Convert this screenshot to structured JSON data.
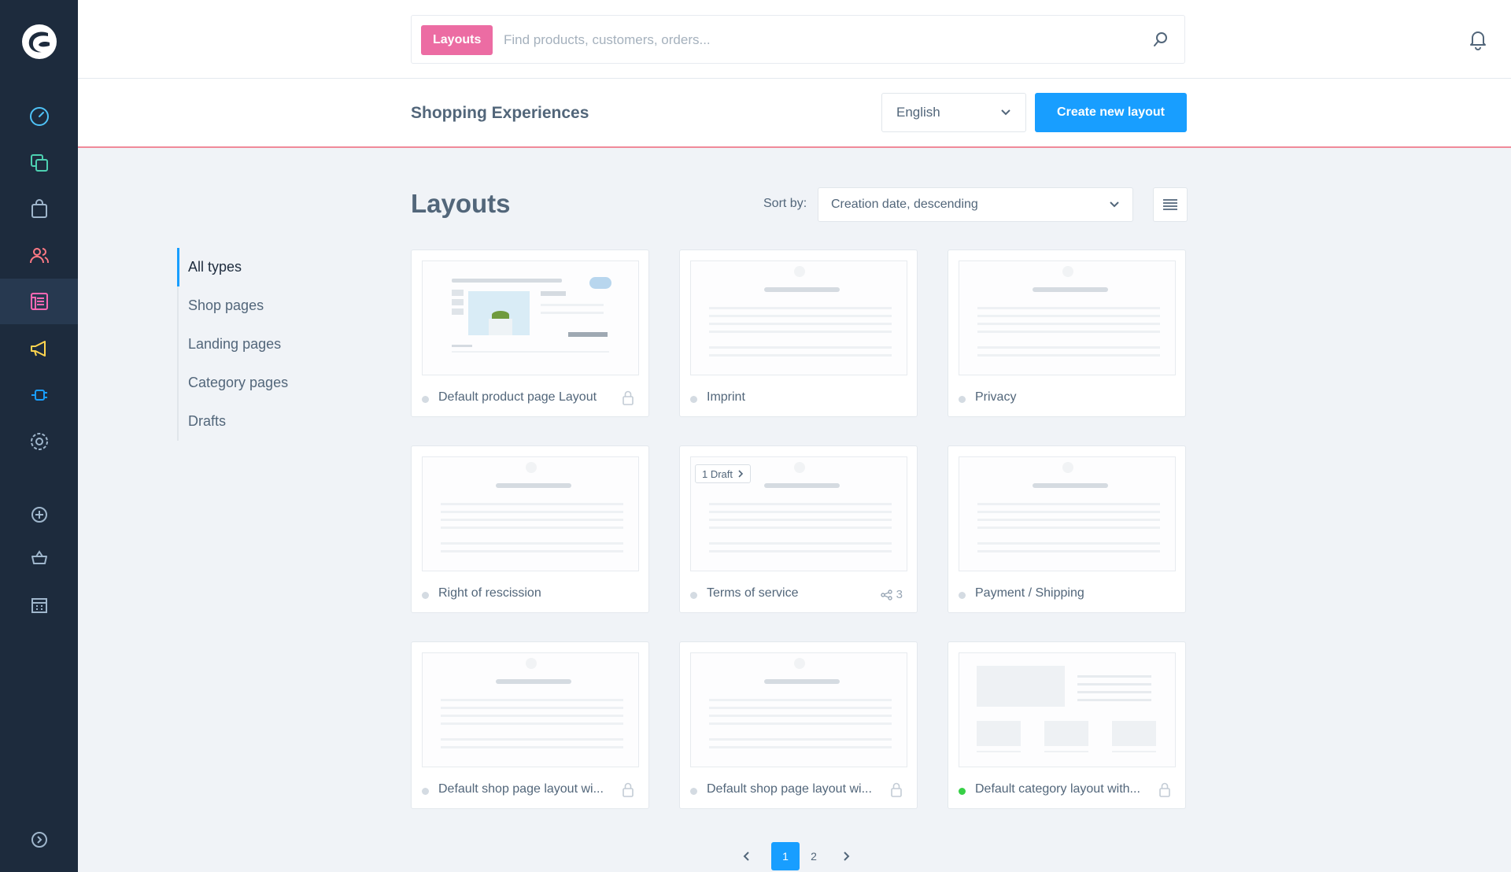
{
  "search": {
    "badge": "Layouts",
    "placeholder": "Find products, customers, orders..."
  },
  "sidebar": {
    "items": [
      {
        "name": "dashboard",
        "icon": "gauge-icon",
        "color": "#4fc3f7"
      },
      {
        "name": "catalogues",
        "icon": "copy-icon",
        "color": "#4dd0b1"
      },
      {
        "name": "orders",
        "icon": "bag-icon",
        "color": "#9fb6cc"
      },
      {
        "name": "customers",
        "icon": "users-icon",
        "color": "#ff7a85"
      },
      {
        "name": "content",
        "icon": "content-icon",
        "color": "#ff68b4",
        "active": true
      },
      {
        "name": "marketing",
        "icon": "megaphone-icon",
        "color": "#ffd54f"
      },
      {
        "name": "extensions",
        "icon": "plug-icon",
        "color": "#189eff"
      },
      {
        "name": "settings",
        "icon": "gear-icon",
        "color": "#9fb6cc"
      },
      {
        "name": "add",
        "icon": "plus-circle-icon",
        "color": "#9fb6cc"
      },
      {
        "name": "shop",
        "icon": "basket-icon",
        "color": "#9fb6cc"
      },
      {
        "name": "storefront",
        "icon": "store-icon",
        "color": "#9fb6cc"
      },
      {
        "name": "expand",
        "icon": "chevron-right-circle-icon",
        "color": "#9fb6cc"
      }
    ]
  },
  "header": {
    "title": "Shopping Experiences",
    "language": "English",
    "create_label": "Create new layout"
  },
  "filters": [
    {
      "label": "All types",
      "active": true
    },
    {
      "label": "Shop pages"
    },
    {
      "label": "Landing pages"
    },
    {
      "label": "Category pages"
    },
    {
      "label": "Drafts"
    }
  ],
  "main": {
    "title": "Layouts",
    "sort_label": "Sort by:",
    "sort_value": "Creation date, descending"
  },
  "cards": [
    {
      "name": "Default product page Layout",
      "locked": true,
      "preview": "product"
    },
    {
      "name": "Imprint",
      "preview": "text"
    },
    {
      "name": "Privacy",
      "preview": "text"
    },
    {
      "name": "Right of rescission",
      "preview": "text"
    },
    {
      "name": "Terms of service",
      "preview": "text",
      "draft": "1 Draft",
      "assignments": "3"
    },
    {
      "name": "Payment / Shipping",
      "preview": "text"
    },
    {
      "name": "Default shop page layout wi...",
      "locked": true,
      "preview": "text"
    },
    {
      "name": "Default shop page layout wi...",
      "locked": true,
      "preview": "text"
    },
    {
      "name": "Default category layout with...",
      "locked": true,
      "active": true,
      "preview": "category"
    }
  ],
  "pagination": {
    "pages": [
      "1",
      "2"
    ],
    "current": "1"
  },
  "colors": {
    "sidebar": "#1d2b3d",
    "primary": "#189eff",
    "badge": "#ec6ca3",
    "header_border": "#f08a9a"
  }
}
